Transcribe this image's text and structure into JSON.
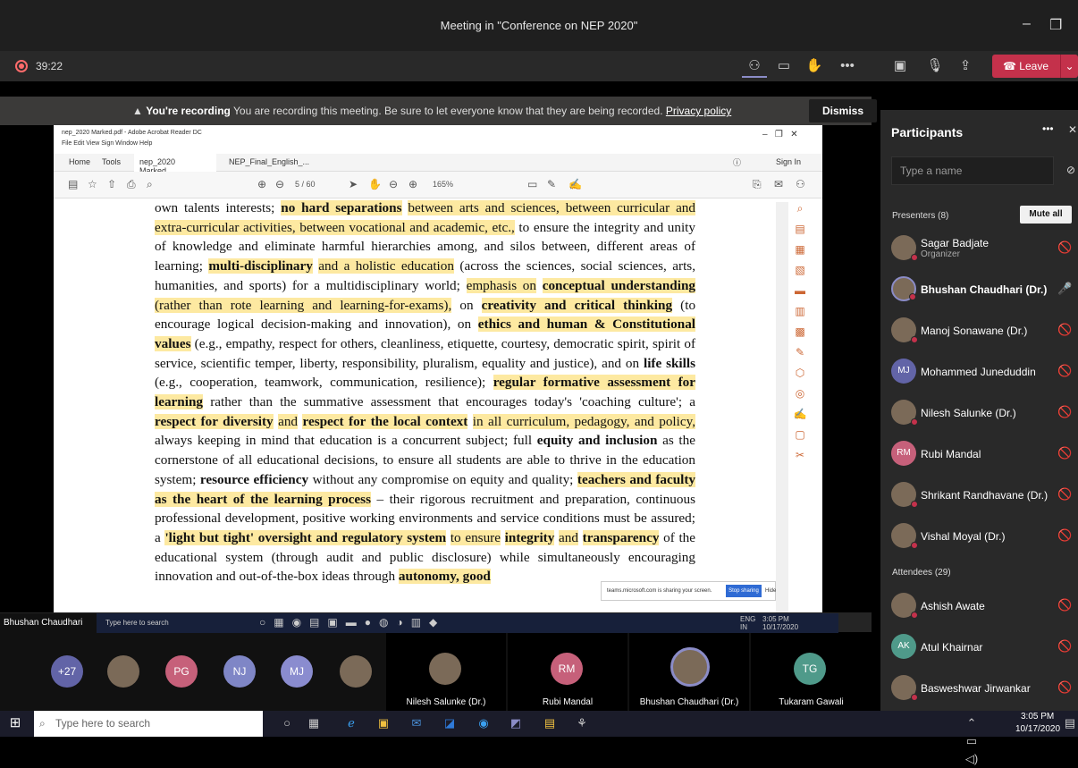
{
  "title": "Meeting in \"Conference on NEP 2020\"",
  "timer": "39:22",
  "leave_label": "Leave",
  "banner": {
    "strong": "You're recording",
    "text": "You are recording this meeting. Be sure to let everyone know that they are being recorded.",
    "link": "Privacy policy",
    "dismiss": "Dismiss"
  },
  "acrobat": {
    "window_title": "nep_2020 Marked.pdf - Adobe Acrobat Reader DC",
    "menu": "File  Edit  View  Sign  Window  Help",
    "home": "Home",
    "tools": "Tools",
    "tab1": "nep_2020 Marked...",
    "tab2": "NEP_Final_English_...",
    "sign_in": "Sign In",
    "page_counter": "5 / 60",
    "zoom": "165%"
  },
  "doc": {
    "p1": "own talents interests;",
    "p2": "no hard separations",
    "p3": "between arts and sciences, between curricular and extra-curricular activities, between vocational and academic, etc.,",
    "p4": "to ensure the integrity and unity of knowledge and eliminate harmful hierarchies among, and silos between, different areas of learning;",
    "p5": "multi-disciplinary",
    "p6": "and a holistic education",
    "p7": "(across the sciences, social sciences, arts, humanities, and sports) for a multidisciplinary world;",
    "p8": "emphasis on",
    "p9": "conceptual understanding",
    "p10": "(rather than rote learning and learning-for-exams),",
    "p11": "on",
    "p12": "creativity and critical thinking",
    "p13": "(to encourage logical decision-making and innovation), on",
    "p14": "ethics and human & Constitutional values",
    "p15": "(e.g., empathy, respect for others, cleanliness, etiquette, courtesy, democratic spirit, spirit of service, scientific temper, liberty, responsibility, pluralism, equality and justice), and on",
    "p16": "life skills",
    "p17": "(e.g., cooperation, teamwork, communication, resilience);",
    "p18": "regular formative assessment for learning",
    "p19": "rather than the summative assessment that encourages today's 'coaching culture'; a",
    "p20": "respect for diversity",
    "p21": "and",
    "p22": "respect for the local context",
    "p23": "in all curriculum, pedagogy, and policy,",
    "p24": "always keeping in mind that education is a concurrent subject; full",
    "p25": "equity and inclusion",
    "p26": "as the cornerstone of all educational decisions, to ensure all students are able to thrive in the education system;",
    "p27": "resource efficiency",
    "p28": "without any compromise on equity and quality;",
    "p29": "teachers and faculty as the heart of the learning process",
    "p30": "– their rigorous recruitment and preparation, continuous professional development, positive working environments and service conditions must be assured; a",
    "p31": "'light but tight' oversight and regulatory system",
    "p32": "to ensure",
    "p33": "integrity",
    "p34": "and",
    "p35": "transparency",
    "p36": "of the educational system (through audit and public disclosure) while simultaneously encouraging innovation and out-of-the-box ideas through",
    "p37": "autonomy, good"
  },
  "share_notice": {
    "text": "teams.microsoft.com is sharing your screen.",
    "stop": "Stop sharing",
    "hide": "Hide"
  },
  "presenter_chip": "Bhushan Chaudhari (Dr.)",
  "inner_search": "Type here to search",
  "inner_clock": {
    "time": "3:05 PM",
    "date": "10/17/2020",
    "lang": "ENG",
    "region": "IN"
  },
  "participants": {
    "title": "Participants",
    "search_placeholder": "Type a name",
    "presenters_label": "Presenters (8)",
    "mute_all": "Mute all",
    "presenters": [
      {
        "name": "Sagar Badjate",
        "sub": "Organizer",
        "initials": ""
      },
      {
        "name": "Bhushan Chaudhari (Dr.)",
        "initials": ""
      },
      {
        "name": "Manoj Sonawane (Dr.)",
        "initials": ""
      },
      {
        "name": "Mohammed Juneduddin",
        "initials": "MJ"
      },
      {
        "name": "Nilesh Salunke (Dr.)",
        "initials": ""
      },
      {
        "name": "Rubi Mandal",
        "initials": "RM"
      },
      {
        "name": "Shrikant Randhavane (Dr.)",
        "initials": ""
      },
      {
        "name": "Vishal Moyal (Dr.)",
        "initials": ""
      }
    ],
    "attendees_label": "Attendees (29)",
    "attendees": [
      {
        "name": "Ashish Awate",
        "initials": ""
      },
      {
        "name": "Atul Khairnar",
        "initials": "AK"
      },
      {
        "name": "Basweshwar Jirwankar",
        "initials": ""
      }
    ]
  },
  "tiles": {
    "more": "+27",
    "pg": "PG",
    "nj": "NJ",
    "mj": "MJ",
    "rm": "RM",
    "tg": "TG",
    "t1": "Nilesh Salunke (Dr.)",
    "t2": "Rubi Mandal",
    "t3": "Bhushan Chaudhari (Dr.)",
    "t4": "Tukaram Gawali"
  },
  "taskbar": {
    "search": "Type here to search",
    "time": "3:05 PM",
    "date": "10/17/2020"
  }
}
